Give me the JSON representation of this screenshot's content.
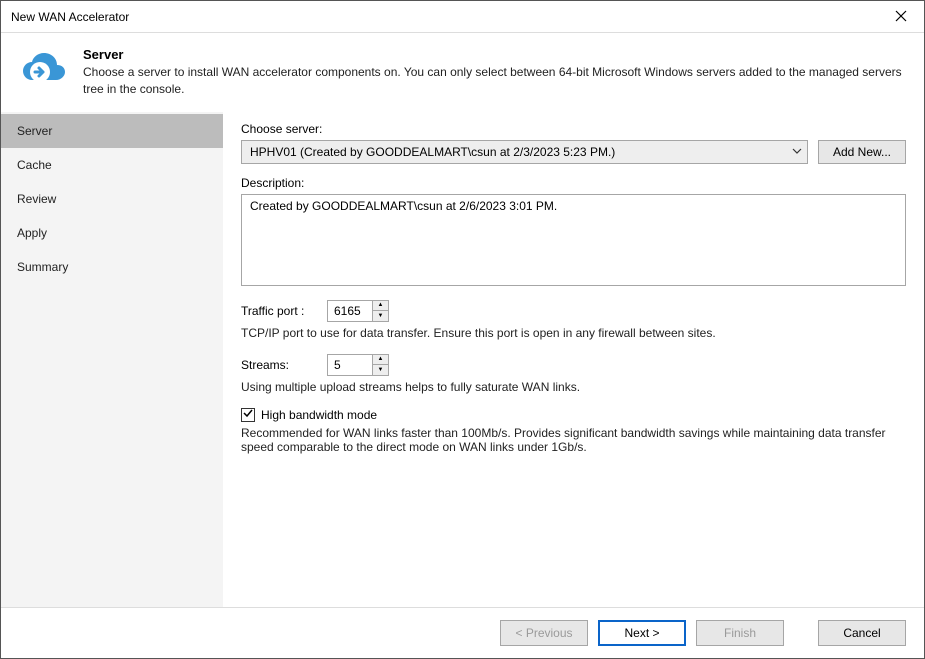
{
  "titlebar": {
    "title": "New WAN Accelerator"
  },
  "header": {
    "title": "Server",
    "desc": "Choose a server to install WAN accelerator components on. You can only select between 64-bit Microsoft Windows servers added to the managed servers tree in the console."
  },
  "sidebar": {
    "items": [
      {
        "label": "Server",
        "active": true
      },
      {
        "label": "Cache",
        "active": false
      },
      {
        "label": "Review",
        "active": false
      },
      {
        "label": "Apply",
        "active": false
      },
      {
        "label": "Summary",
        "active": false
      }
    ]
  },
  "content": {
    "choose_server_label": "Choose server:",
    "server_selected": "HPHV01 (Created by GOODDEALMART\\csun at 2/3/2023 5:23 PM.)",
    "add_new_label": "Add New...",
    "description_label": "Description:",
    "description_value": "Created by GOODDEALMART\\csun at 2/6/2023 3:01 PM.",
    "traffic_port_label": "Traffic port :",
    "traffic_port_value": "6165",
    "traffic_port_hint": "TCP/IP port to use for data transfer. Ensure this port is open in any firewall between sites.",
    "streams_label": "Streams:",
    "streams_value": "5",
    "streams_hint": "Using multiple upload streams helps to fully saturate WAN links.",
    "high_bw_label": "High bandwidth mode",
    "high_bw_checked": true,
    "high_bw_hint": "Recommended for WAN links faster than 100Mb/s. Provides significant bandwidth savings while maintaining data transfer speed comparable to the direct mode on WAN links under 1Gb/s."
  },
  "footer": {
    "previous": "< Previous",
    "next": "Next >",
    "finish": "Finish",
    "cancel": "Cancel"
  }
}
